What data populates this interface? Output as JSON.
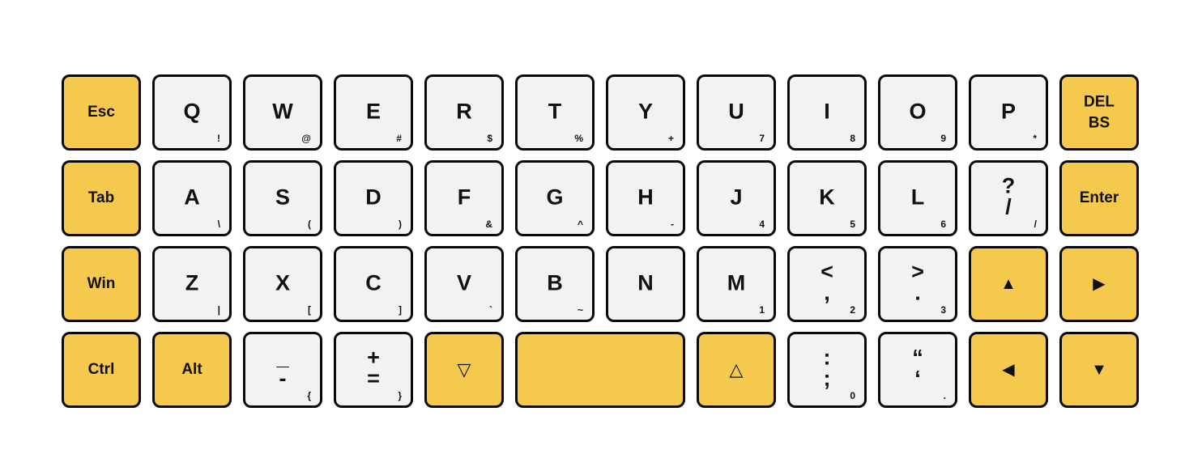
{
  "keyboard": {
    "colors": {
      "modifier_key": "#f4c94e",
      "letter_key": "#f2f2f2",
      "border": "#0a0a0a",
      "text": "#111111"
    },
    "rows": [
      [
        {
          "name": "key-esc",
          "type": "mod",
          "lines": [
            "Esc"
          ],
          "sub": ""
        },
        {
          "name": "key-q",
          "type": "letter",
          "lines": [
            "Q"
          ],
          "sub": "!"
        },
        {
          "name": "key-w",
          "type": "letter",
          "lines": [
            "W"
          ],
          "sub": "@"
        },
        {
          "name": "key-e",
          "type": "letter",
          "lines": [
            "E"
          ],
          "sub": "#"
        },
        {
          "name": "key-r",
          "type": "letter",
          "lines": [
            "R"
          ],
          "sub": "$"
        },
        {
          "name": "key-t",
          "type": "letter",
          "lines": [
            "T"
          ],
          "sub": "%"
        },
        {
          "name": "key-y",
          "type": "letter",
          "lines": [
            "Y"
          ],
          "sub": "+"
        },
        {
          "name": "key-u",
          "type": "letter",
          "lines": [
            "U"
          ],
          "sub": "7"
        },
        {
          "name": "key-i",
          "type": "letter",
          "lines": [
            "I"
          ],
          "sub": "8"
        },
        {
          "name": "key-o",
          "type": "letter",
          "lines": [
            "O"
          ],
          "sub": "9"
        },
        {
          "name": "key-p",
          "type": "letter",
          "lines": [
            "P"
          ],
          "sub": "*"
        },
        {
          "name": "key-del-bs",
          "type": "mod",
          "lines": [
            "DEL",
            "BS"
          ],
          "sub": ""
        }
      ],
      [
        {
          "name": "key-tab",
          "type": "mod",
          "lines": [
            "Tab"
          ],
          "sub": ""
        },
        {
          "name": "key-a",
          "type": "letter",
          "lines": [
            "A"
          ],
          "sub": "\\"
        },
        {
          "name": "key-s",
          "type": "letter",
          "lines": [
            "S"
          ],
          "sub": "("
        },
        {
          "name": "key-d",
          "type": "letter",
          "lines": [
            "D"
          ],
          "sub": ")"
        },
        {
          "name": "key-f",
          "type": "letter",
          "lines": [
            "F"
          ],
          "sub": "&"
        },
        {
          "name": "key-g",
          "type": "letter",
          "lines": [
            "G"
          ],
          "sub": "^"
        },
        {
          "name": "key-h",
          "type": "letter",
          "lines": [
            "H"
          ],
          "sub": "-"
        },
        {
          "name": "key-j",
          "type": "letter",
          "lines": [
            "J"
          ],
          "sub": "4"
        },
        {
          "name": "key-k",
          "type": "letter",
          "lines": [
            "K"
          ],
          "sub": "5"
        },
        {
          "name": "key-l",
          "type": "letter",
          "lines": [
            "L"
          ],
          "sub": "6"
        },
        {
          "name": "key-question-slash",
          "type": "letter",
          "lines": [
            "?",
            "/"
          ],
          "sub": "/"
        },
        {
          "name": "key-enter",
          "type": "mod",
          "lines": [
            "Enter"
          ],
          "sub": ""
        }
      ],
      [
        {
          "name": "key-win",
          "type": "mod",
          "lines": [
            "Win"
          ],
          "sub": ""
        },
        {
          "name": "key-z",
          "type": "letter",
          "lines": [
            "Z"
          ],
          "sub": "|"
        },
        {
          "name": "key-x",
          "type": "letter",
          "lines": [
            "X"
          ],
          "sub": "["
        },
        {
          "name": "key-c",
          "type": "letter",
          "lines": [
            "C"
          ],
          "sub": "]"
        },
        {
          "name": "key-v",
          "type": "letter",
          "lines": [
            "V"
          ],
          "sub": "`"
        },
        {
          "name": "key-b",
          "type": "letter",
          "lines": [
            "B"
          ],
          "sub": "~"
        },
        {
          "name": "key-n",
          "type": "letter",
          "lines": [
            "N"
          ],
          "sub": ""
        },
        {
          "name": "key-m",
          "type": "letter",
          "lines": [
            "M"
          ],
          "sub": "1"
        },
        {
          "name": "key-less-comma",
          "type": "letter",
          "lines": [
            "<",
            ","
          ],
          "sub": "2"
        },
        {
          "name": "key-greater-period",
          "type": "letter",
          "lines": [
            ">",
            "."
          ],
          "sub": "3"
        },
        {
          "name": "key-arrow-up",
          "type": "mod",
          "icon": "arrow-up-icon",
          "lines": [
            "▲"
          ],
          "sub": ""
        },
        {
          "name": "key-arrow-right",
          "type": "mod",
          "icon": "arrow-right-icon",
          "lines": [
            "▶"
          ],
          "sub": ""
        }
      ],
      [
        {
          "name": "key-ctrl",
          "type": "mod",
          "lines": [
            "Ctrl"
          ],
          "sub": ""
        },
        {
          "name": "key-alt",
          "type": "mod",
          "lines": [
            "Alt"
          ],
          "sub": ""
        },
        {
          "name": "key-underscore-minus",
          "type": "letter",
          "lines": [
            "_",
            "-"
          ],
          "sub": "{"
        },
        {
          "name": "key-plus-equals",
          "type": "letter",
          "lines": [
            "+",
            "="
          ],
          "sub": "}"
        },
        {
          "name": "key-lower-layer",
          "type": "mod",
          "icon": "triangle-down-outline-icon",
          "lines": [
            "▽"
          ],
          "sub": ""
        },
        {
          "name": "key-space",
          "type": "mod",
          "lines": [],
          "sub": ""
        },
        {
          "name": "key-raise-layer",
          "type": "mod",
          "icon": "triangle-up-outline-icon",
          "lines": [
            "△"
          ],
          "sub": ""
        },
        {
          "name": "key-colon-semicolon",
          "type": "letter",
          "lines": [
            ":",
            ";"
          ],
          "sub": "0"
        },
        {
          "name": "key-quote",
          "type": "letter",
          "lines": [
            "“",
            "‘"
          ],
          "sub": "."
        },
        {
          "name": "key-arrow-left",
          "type": "mod",
          "icon": "arrow-left-icon",
          "lines": [
            "◀"
          ],
          "sub": ""
        },
        {
          "name": "key-arrow-down",
          "type": "mod",
          "icon": "arrow-down-icon",
          "lines": [
            "▼"
          ],
          "sub": ""
        }
      ]
    ]
  }
}
